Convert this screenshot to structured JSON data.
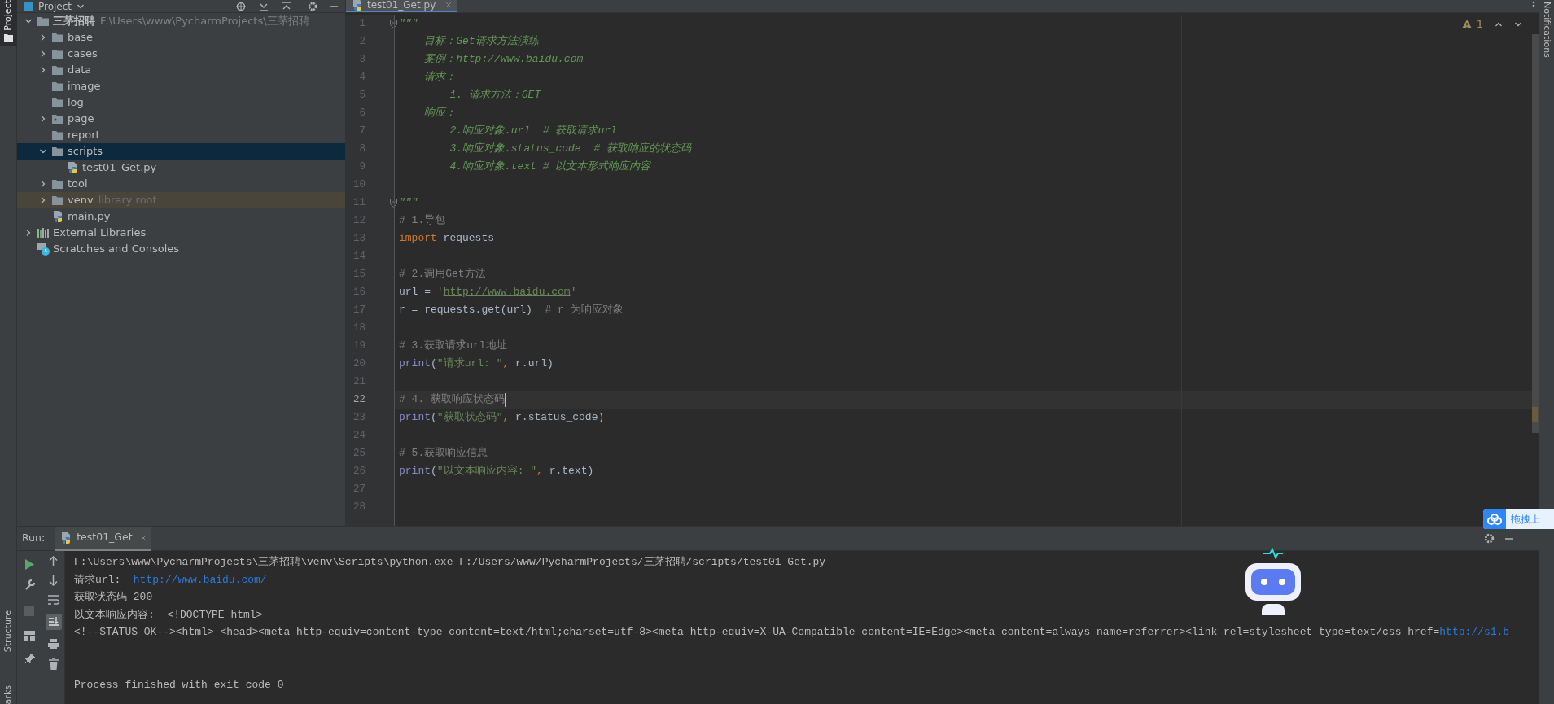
{
  "left_stripe": {
    "top_tab": {
      "label": "Project",
      "selected": true
    },
    "bottom_tabs": [
      "Structure",
      "arks"
    ]
  },
  "project_panel": {
    "title": "Project",
    "tree": [
      {
        "label": "三茅招聘",
        "path": "F:\\Users\\www\\PycharmProjects\\三茅招聘",
        "kind": "root",
        "expanded": true,
        "selected": false,
        "children": [
          {
            "label": "base",
            "kind": "folder",
            "expanded": false,
            "selected": false
          },
          {
            "label": "cases",
            "kind": "folder",
            "expanded": false,
            "selected": false
          },
          {
            "label": "data",
            "kind": "folder",
            "expanded": false,
            "selected": false
          },
          {
            "label": "image",
            "kind": "folder",
            "selected": false
          },
          {
            "label": "log",
            "kind": "folder",
            "selected": false
          },
          {
            "label": "page",
            "kind": "package",
            "expanded": false,
            "selected": false
          },
          {
            "label": "report",
            "kind": "folder",
            "selected": false
          },
          {
            "label": "scripts",
            "kind": "folder",
            "expanded": true,
            "selected": true,
            "children": [
              {
                "label": "test01_Get.py",
                "kind": "python-file",
                "selected": false
              }
            ]
          },
          {
            "label": "tool",
            "kind": "folder",
            "expanded": false,
            "selected": false
          },
          {
            "label": "venv",
            "hint": "library root",
            "kind": "library-root",
            "expanded": false,
            "selected": false
          },
          {
            "label": "main.py",
            "kind": "python-file",
            "selected": false
          }
        ]
      },
      {
        "label": "External Libraries",
        "kind": "libraries",
        "expanded": false,
        "selected": false
      },
      {
        "label": "Scratches and Consoles",
        "kind": "scratches",
        "selected": false
      }
    ]
  },
  "editor": {
    "tab": {
      "label": "test01_Get.py",
      "selected": true
    },
    "warning_count": "1",
    "lines": [
      {
        "number": "1",
        "current": false,
        "fold": true,
        "tokens": [
          {
            "kind": "doc",
            "text": "\"\"\""
          }
        ]
      },
      {
        "number": "2",
        "current": false,
        "tokens": [
          {
            "kind": "doc",
            "text": "    目标：Get请求方法演练"
          }
        ]
      },
      {
        "number": "3",
        "current": false,
        "tokens": [
          {
            "kind": "doc",
            "text": "    案例："
          },
          {
            "kind": "doclink",
            "text": "http://www.baidu.com"
          }
        ]
      },
      {
        "number": "4",
        "current": false,
        "tokens": [
          {
            "kind": "doc",
            "text": "    请求："
          }
        ]
      },
      {
        "number": "5",
        "current": false,
        "tokens": [
          {
            "kind": "doc",
            "text": "        1. 请求方法：GET"
          }
        ]
      },
      {
        "number": "6",
        "current": false,
        "tokens": [
          {
            "kind": "doc",
            "text": "    响应："
          }
        ]
      },
      {
        "number": "7",
        "current": false,
        "tokens": [
          {
            "kind": "doc",
            "text": "        2.响应对象.url  # 获取请求url"
          }
        ]
      },
      {
        "number": "8",
        "current": false,
        "tokens": [
          {
            "kind": "doc",
            "text": "        3.响应对象.status_code  # 获取响应的状态码"
          }
        ]
      },
      {
        "number": "9",
        "current": false,
        "tokens": [
          {
            "kind": "doc",
            "text": "        4.响应对象.text # 以文本形式响应内容"
          }
        ]
      },
      {
        "number": "10",
        "current": false
      },
      {
        "number": "11",
        "current": false,
        "fold": true,
        "tokens": [
          {
            "kind": "doc",
            "text": "\"\"\""
          }
        ]
      },
      {
        "number": "12",
        "current": false,
        "tokens": [
          {
            "kind": "comment",
            "text": "# 1.导包"
          }
        ]
      },
      {
        "number": "13",
        "current": false,
        "tokens": [
          {
            "kind": "keyword",
            "text": "import"
          },
          {
            "kind": "plain",
            "text": " requests"
          }
        ]
      },
      {
        "number": "14",
        "current": false
      },
      {
        "number": "15",
        "current": false,
        "tokens": [
          {
            "kind": "comment",
            "text": "# 2.调用Get方法"
          }
        ]
      },
      {
        "number": "16",
        "current": false,
        "tokens": [
          {
            "kind": "plain",
            "text": "url = "
          },
          {
            "kind": "string",
            "text": "'"
          },
          {
            "kind": "link",
            "text": "http://www.baidu.com"
          },
          {
            "kind": "string",
            "text": "'"
          }
        ]
      },
      {
        "number": "17",
        "current": false,
        "tokens": [
          {
            "kind": "plain",
            "text": "r = requests.get(url)  "
          },
          {
            "kind": "comment",
            "text": "# r 为响应对象"
          }
        ]
      },
      {
        "number": "18",
        "current": false
      },
      {
        "number": "19",
        "current": false,
        "tokens": [
          {
            "kind": "comment",
            "text": "# 3.获取请求url地址"
          }
        ]
      },
      {
        "number": "20",
        "current": false,
        "tokens": [
          {
            "kind": "builtin",
            "text": "print"
          },
          {
            "kind": "plain",
            "text": "("
          },
          {
            "kind": "string",
            "text": "\"请求url: \""
          },
          {
            "kind": "comma",
            "text": ", "
          },
          {
            "kind": "plain",
            "text": "r.url)"
          }
        ]
      },
      {
        "number": "21",
        "current": false
      },
      {
        "number": "22",
        "current": true,
        "tokens": [
          {
            "kind": "comment",
            "text": "# 4. 获取响应状态码"
          }
        ]
      },
      {
        "number": "23",
        "current": false,
        "tokens": [
          {
            "kind": "builtin",
            "text": "print"
          },
          {
            "kind": "plain",
            "text": "("
          },
          {
            "kind": "string",
            "text": "\"获取状态码\""
          },
          {
            "kind": "comma",
            "text": ", "
          },
          {
            "kind": "plain",
            "text": "r.status_code)"
          }
        ]
      },
      {
        "number": "24",
        "current": false
      },
      {
        "number": "25",
        "current": false,
        "tokens": [
          {
            "kind": "comment",
            "text": "# 5.获取响应信息"
          }
        ]
      },
      {
        "number": "26",
        "current": false,
        "tokens": [
          {
            "kind": "builtin",
            "text": "print"
          },
          {
            "kind": "plain",
            "text": "("
          },
          {
            "kind": "string",
            "text": "\"以文本响应内容: \""
          },
          {
            "kind": "comma",
            "text": ", "
          },
          {
            "kind": "plain",
            "text": "r.text)"
          }
        ]
      },
      {
        "number": "27",
        "current": false
      },
      {
        "number": "28",
        "current": false
      }
    ]
  },
  "right_stripe": {
    "label": "Notifications"
  },
  "run_panel": {
    "label": "Run:",
    "tab": {
      "label": "test01_Get",
      "selected": true
    },
    "output": [
      {
        "kind": "command",
        "parts": [
          {
            "kind": "text",
            "text": "F:\\Users\\www\\PycharmProjects\\三茅招聘\\venv\\Scripts\\python.exe F:/Users/www/PycharmProjects/三茅招聘/scripts/test01_Get.py"
          }
        ]
      },
      {
        "kind": "output",
        "parts": [
          {
            "kind": "text",
            "text": "请求url:  "
          },
          {
            "kind": "link",
            "text": "http://www.baidu.com/"
          }
        ]
      },
      {
        "kind": "output",
        "parts": [
          {
            "kind": "text",
            "text": "获取状态码 200"
          }
        ]
      },
      {
        "kind": "output",
        "parts": [
          {
            "kind": "text",
            "text": "以文本响应内容:  <!DOCTYPE html>"
          }
        ]
      },
      {
        "kind": "output",
        "parts": [
          {
            "kind": "text",
            "text": "<!--STATUS OK--><html> <head><meta http-equiv=content-type content=text/html;charset=utf-8><meta http-equiv=X-UA-Compatible content=IE=Edge><meta content=always name=referrer><link rel=stylesheet type=text/css href="
          },
          {
            "kind": "link",
            "text": "http://s1.b"
          }
        ]
      },
      {
        "kind": "exit",
        "parts": [
          {
            "kind": "text",
            "text": "Process finished with exit code 0"
          }
        ]
      }
    ]
  },
  "upload_badge": {
    "label": "拖拽上"
  }
}
